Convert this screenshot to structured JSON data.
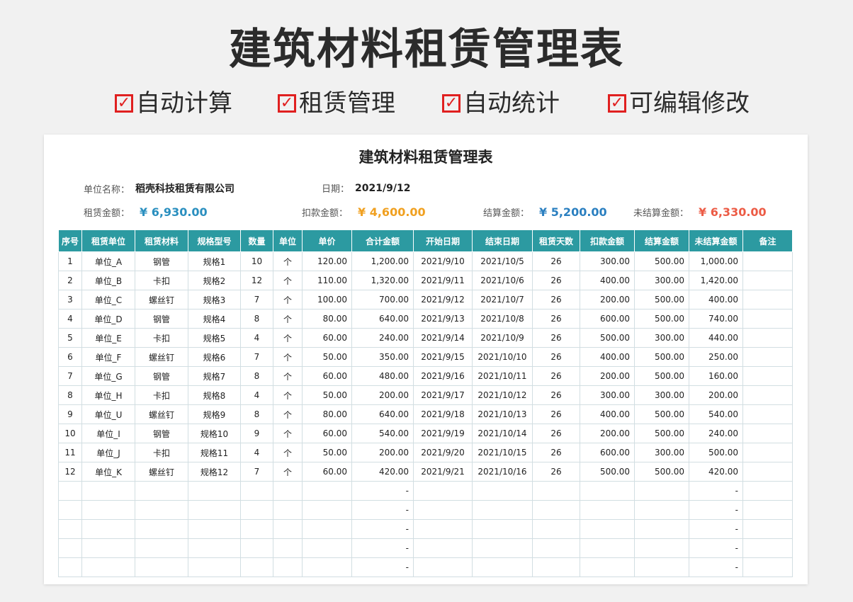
{
  "banner": {
    "title": "建筑材料租赁管理表",
    "check_mark": "✓",
    "features": [
      "自动计算",
      "租赁管理",
      "自动统计",
      "可编辑修改"
    ]
  },
  "sheet": {
    "title": "建筑材料租赁管理表",
    "unit_label": "单位名称：",
    "unit_value": "稻壳科技租赁有限公司",
    "date_label": "日期：",
    "date_value": "2021/9/12",
    "amounts": [
      {
        "label": "租赁金额：",
        "value": "¥ 6,930.00",
        "color": "#2a8fbf"
      },
      {
        "label": "扣款金额：",
        "value": "¥ 4,600.00",
        "color": "#f0a020"
      },
      {
        "label": "结算金额：",
        "value": "¥ 5,200.00",
        "color": "#2a7fc0"
      },
      {
        "label": "未结算金额：",
        "value": "¥ 6,330.00",
        "color": "#ec5b45"
      }
    ]
  },
  "table": {
    "headers": [
      "序号",
      "租赁单位",
      "租赁材料",
      "规格型号",
      "数量",
      "单位",
      "单价",
      "合计金额",
      "开始日期",
      "结束日期",
      "租赁天数",
      "扣款金额",
      "结算金额",
      "未结算金额",
      "备注"
    ],
    "rows": [
      [
        "1",
        "单位_A",
        "钢管",
        "规格1",
        "10",
        "个",
        "120.00",
        "1,200.00",
        "2021/9/10",
        "2021/10/5",
        "26",
        "300.00",
        "500.00",
        "1,000.00",
        ""
      ],
      [
        "2",
        "单位_B",
        "卡扣",
        "规格2",
        "12",
        "个",
        "110.00",
        "1,320.00",
        "2021/9/11",
        "2021/10/6",
        "26",
        "400.00",
        "300.00",
        "1,420.00",
        ""
      ],
      [
        "3",
        "单位_C",
        "螺丝钉",
        "规格3",
        "7",
        "个",
        "100.00",
        "700.00",
        "2021/9/12",
        "2021/10/7",
        "26",
        "200.00",
        "500.00",
        "400.00",
        ""
      ],
      [
        "4",
        "单位_D",
        "钢管",
        "规格4",
        "8",
        "个",
        "80.00",
        "640.00",
        "2021/9/13",
        "2021/10/8",
        "26",
        "600.00",
        "500.00",
        "740.00",
        ""
      ],
      [
        "5",
        "单位_E",
        "卡扣",
        "规格5",
        "4",
        "个",
        "60.00",
        "240.00",
        "2021/9/14",
        "2021/10/9",
        "26",
        "500.00",
        "300.00",
        "440.00",
        ""
      ],
      [
        "6",
        "单位_F",
        "螺丝钉",
        "规格6",
        "7",
        "个",
        "50.00",
        "350.00",
        "2021/9/15",
        "2021/10/10",
        "26",
        "400.00",
        "500.00",
        "250.00",
        ""
      ],
      [
        "7",
        "单位_G",
        "钢管",
        "规格7",
        "8",
        "个",
        "60.00",
        "480.00",
        "2021/9/16",
        "2021/10/11",
        "26",
        "200.00",
        "500.00",
        "160.00",
        ""
      ],
      [
        "8",
        "单位_H",
        "卡扣",
        "规格8",
        "4",
        "个",
        "50.00",
        "200.00",
        "2021/9/17",
        "2021/10/12",
        "26",
        "300.00",
        "300.00",
        "200.00",
        ""
      ],
      [
        "9",
        "单位_U",
        "螺丝钉",
        "规格9",
        "8",
        "个",
        "80.00",
        "640.00",
        "2021/9/18",
        "2021/10/13",
        "26",
        "400.00",
        "500.00",
        "540.00",
        ""
      ],
      [
        "10",
        "单位_I",
        "钢管",
        "规格10",
        "9",
        "个",
        "60.00",
        "540.00",
        "2021/9/19",
        "2021/10/14",
        "26",
        "200.00",
        "500.00",
        "240.00",
        ""
      ],
      [
        "11",
        "单位_J",
        "卡扣",
        "规格11",
        "4",
        "个",
        "50.00",
        "200.00",
        "2021/9/20",
        "2021/10/15",
        "26",
        "600.00",
        "300.00",
        "500.00",
        ""
      ],
      [
        "12",
        "单位_K",
        "螺丝钉",
        "规格12",
        "7",
        "个",
        "60.00",
        "420.00",
        "2021/9/21",
        "2021/10/16",
        "26",
        "500.00",
        "500.00",
        "420.00",
        ""
      ],
      [
        "",
        "",
        "",
        "",
        "",
        "",
        "",
        "-",
        "",
        "",
        "",
        "",
        "",
        "-",
        ""
      ],
      [
        "",
        "",
        "",
        "",
        "",
        "",
        "",
        "-",
        "",
        "",
        "",
        "",
        "",
        "-",
        ""
      ],
      [
        "",
        "",
        "",
        "",
        "",
        "",
        "",
        "-",
        "",
        "",
        "",
        "",
        "",
        "-",
        ""
      ],
      [
        "",
        "",
        "",
        "",
        "",
        "",
        "",
        "-",
        "",
        "",
        "",
        "",
        "",
        "-",
        ""
      ],
      [
        "",
        "",
        "",
        "",
        "",
        "",
        "",
        "-",
        "",
        "",
        "",
        "",
        "",
        "-",
        ""
      ]
    ]
  }
}
